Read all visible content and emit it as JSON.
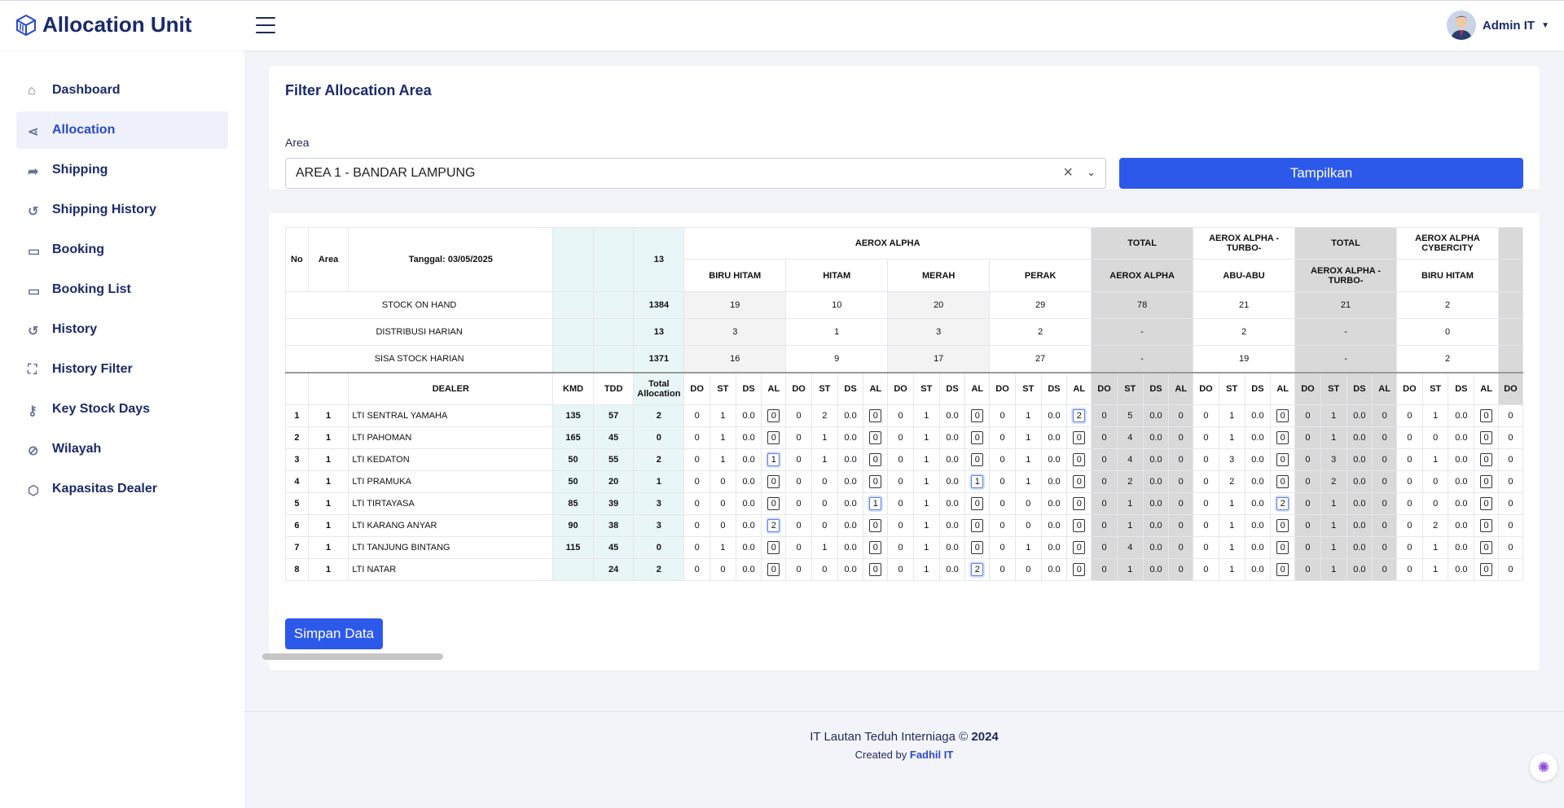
{
  "app": {
    "title": "Allocation Unit"
  },
  "user": {
    "name": "Admin IT"
  },
  "sidebar": {
    "items": [
      {
        "label": "Dashboard",
        "icon": "home-icon"
      },
      {
        "label": "Allocation",
        "icon": "share-icon",
        "active": true
      },
      {
        "label": "Shipping",
        "icon": "forward-icon"
      },
      {
        "label": "Shipping History",
        "icon": "history-icon"
      },
      {
        "label": "Booking",
        "icon": "calendar-icon"
      },
      {
        "label": "Booking List",
        "icon": "calendar-icon"
      },
      {
        "label": "History",
        "icon": "history-icon"
      },
      {
        "label": "History Filter",
        "icon": "filter-icon"
      },
      {
        "label": "Key Stock Days",
        "icon": "key-icon"
      },
      {
        "label": "Wilayah",
        "icon": "compass-icon"
      },
      {
        "label": "Kapasitas Dealer",
        "icon": "box-icon"
      }
    ]
  },
  "filter": {
    "title": "Filter Allocation Area",
    "area_label": "Area",
    "area_value": "AREA 1 - BANDAR LAMPUNG",
    "button": "Tampilkan"
  },
  "table": {
    "h_no": "No",
    "h_area": "Area",
    "h_date": "Tanggal: 03/05/2025",
    "h_total_top": "13",
    "groups": [
      "AEROX ALPHA",
      "TOTAL",
      "AEROX ALPHA - TURBO-",
      "TOTAL",
      "AEROX ALPHA CYBERCITY"
    ],
    "colors": [
      "BIRU HITAM",
      "HITAM",
      "MERAH",
      "PERAK",
      "AEROX ALPHA",
      "ABU-ABU",
      "AEROX ALPHA - TURBO-",
      "BIRU HITAM"
    ],
    "summary": [
      {
        "label": "STOCK ON HAND",
        "total": "1384",
        "vals": [
          "19",
          "10",
          "20",
          "29",
          "78",
          "21",
          "21",
          "2"
        ]
      },
      {
        "label": "DISTRIBUSI HARIAN",
        "total": "13",
        "vals": [
          "3",
          "1",
          "3",
          "2",
          "-",
          "2",
          "-",
          "0"
        ]
      },
      {
        "label": "SISA STOCK HARIAN",
        "total": "1371",
        "vals": [
          "16",
          "9",
          "17",
          "27",
          "-",
          "19",
          "-",
          "2"
        ]
      }
    ],
    "h_dealer": "DEALER",
    "h_kmd": "KMD",
    "h_tdd": "TDD",
    "h_total_alloc": "Total Allocation",
    "sub": [
      "DO",
      "ST",
      "DS",
      "AL"
    ],
    "rows": [
      {
        "no": "1",
        "area": "1",
        "dealer": "LTI SENTRAL YAMAHA",
        "kmd": "135",
        "tdd": "57",
        "total": "2",
        "c": [
          [
            "0",
            "1",
            "0.0",
            "0"
          ],
          [
            "0",
            "2",
            "0.0",
            "0"
          ],
          [
            "0",
            "1",
            "0.0",
            "0"
          ],
          [
            "0",
            "1",
            "0.0",
            "2"
          ],
          [
            "0",
            "5",
            "0.0",
            "0"
          ],
          [
            "0",
            "1",
            "0.0",
            "0"
          ],
          [
            "0",
            "1",
            "0.0",
            "0"
          ],
          [
            "0",
            "1",
            "0.0",
            "0"
          ]
        ]
      },
      {
        "no": "2",
        "area": "1",
        "dealer": "LTI PAHOMAN",
        "kmd": "165",
        "tdd": "45",
        "total": "0",
        "c": [
          [
            "0",
            "1",
            "0.0",
            "0"
          ],
          [
            "0",
            "1",
            "0.0",
            "0"
          ],
          [
            "0",
            "1",
            "0.0",
            "0"
          ],
          [
            "0",
            "1",
            "0.0",
            "0"
          ],
          [
            "0",
            "4",
            "0.0",
            "0"
          ],
          [
            "0",
            "1",
            "0.0",
            "0"
          ],
          [
            "0",
            "1",
            "0.0",
            "0"
          ],
          [
            "0",
            "0",
            "0.0",
            "0"
          ]
        ]
      },
      {
        "no": "3",
        "area": "1",
        "dealer": "LTI KEDATON",
        "kmd": "50",
        "tdd": "55",
        "total": "2",
        "c": [
          [
            "0",
            "1",
            "0.0",
            "1"
          ],
          [
            "0",
            "1",
            "0.0",
            "0"
          ],
          [
            "0",
            "1",
            "0.0",
            "0"
          ],
          [
            "0",
            "1",
            "0.0",
            "0"
          ],
          [
            "0",
            "4",
            "0.0",
            "0"
          ],
          [
            "0",
            "3",
            "0.0",
            "0"
          ],
          [
            "0",
            "3",
            "0.0",
            "0"
          ],
          [
            "0",
            "1",
            "0.0",
            "0"
          ]
        ]
      },
      {
        "no": "4",
        "area": "1",
        "dealer": "LTI PRAMUKA",
        "kmd": "50",
        "tdd": "20",
        "total": "1",
        "c": [
          [
            "0",
            "0",
            "0.0",
            "0"
          ],
          [
            "0",
            "0",
            "0.0",
            "0"
          ],
          [
            "0",
            "1",
            "0.0",
            "1"
          ],
          [
            "0",
            "1",
            "0.0",
            "0"
          ],
          [
            "0",
            "2",
            "0.0",
            "0"
          ],
          [
            "0",
            "2",
            "0.0",
            "0"
          ],
          [
            "0",
            "2",
            "0.0",
            "0"
          ],
          [
            "0",
            "0",
            "0.0",
            "0"
          ]
        ]
      },
      {
        "no": "5",
        "area": "1",
        "dealer": "LTI TIRTAYASA",
        "kmd": "85",
        "tdd": "39",
        "total": "3",
        "c": [
          [
            "0",
            "0",
            "0.0",
            "0"
          ],
          [
            "0",
            "0",
            "0.0",
            "1"
          ],
          [
            "0",
            "1",
            "0.0",
            "0"
          ],
          [
            "0",
            "0",
            "0.0",
            "0"
          ],
          [
            "0",
            "1",
            "0.0",
            "0"
          ],
          [
            "0",
            "1",
            "0.0",
            "2"
          ],
          [
            "0",
            "1",
            "0.0",
            "0"
          ],
          [
            "0",
            "0",
            "0.0",
            "0"
          ]
        ]
      },
      {
        "no": "6",
        "area": "1",
        "dealer": "LTI KARANG ANYAR",
        "kmd": "90",
        "tdd": "38",
        "total": "3",
        "c": [
          [
            "0",
            "0",
            "0.0",
            "2"
          ],
          [
            "0",
            "0",
            "0.0",
            "0"
          ],
          [
            "0",
            "1",
            "0.0",
            "0"
          ],
          [
            "0",
            "0",
            "0.0",
            "0"
          ],
          [
            "0",
            "1",
            "0.0",
            "0"
          ],
          [
            "0",
            "1",
            "0.0",
            "0"
          ],
          [
            "0",
            "1",
            "0.0",
            "0"
          ],
          [
            "0",
            "2",
            "0.0",
            "0"
          ]
        ]
      },
      {
        "no": "7",
        "area": "1",
        "dealer": "LTI TANJUNG BINTANG",
        "kmd": "115",
        "tdd": "45",
        "total": "0",
        "c": [
          [
            "0",
            "1",
            "0.0",
            "0"
          ],
          [
            "0",
            "1",
            "0.0",
            "0"
          ],
          [
            "0",
            "1",
            "0.0",
            "0"
          ],
          [
            "0",
            "1",
            "0.0",
            "0"
          ],
          [
            "0",
            "4",
            "0.0",
            "0"
          ],
          [
            "0",
            "1",
            "0.0",
            "0"
          ],
          [
            "0",
            "1",
            "0.0",
            "0"
          ],
          [
            "0",
            "1",
            "0.0",
            "0"
          ]
        ]
      },
      {
        "no": "8",
        "area": "1",
        "dealer": "LTI NATAR",
        "kmd": "",
        "tdd": "24",
        "total": "2",
        "c": [
          [
            "0",
            "0",
            "0.0",
            "0"
          ],
          [
            "0",
            "0",
            "0.0",
            "0"
          ],
          [
            "0",
            "1",
            "0.0",
            "2"
          ],
          [
            "0",
            "0",
            "0.0",
            "0"
          ],
          [
            "0",
            "1",
            "0.0",
            "0"
          ],
          [
            "0",
            "1",
            "0.0",
            "0"
          ],
          [
            "0",
            "1",
            "0.0",
            "0"
          ],
          [
            "0",
            "1",
            "0.0",
            "0"
          ]
        ]
      }
    ],
    "trail": "0"
  },
  "save_button": "Simpan Data",
  "footer": {
    "text": "IT Lautan Teduh Interniaga ©",
    "year": "2024",
    "created_by": "Created by",
    "author": "Fadhil IT"
  }
}
